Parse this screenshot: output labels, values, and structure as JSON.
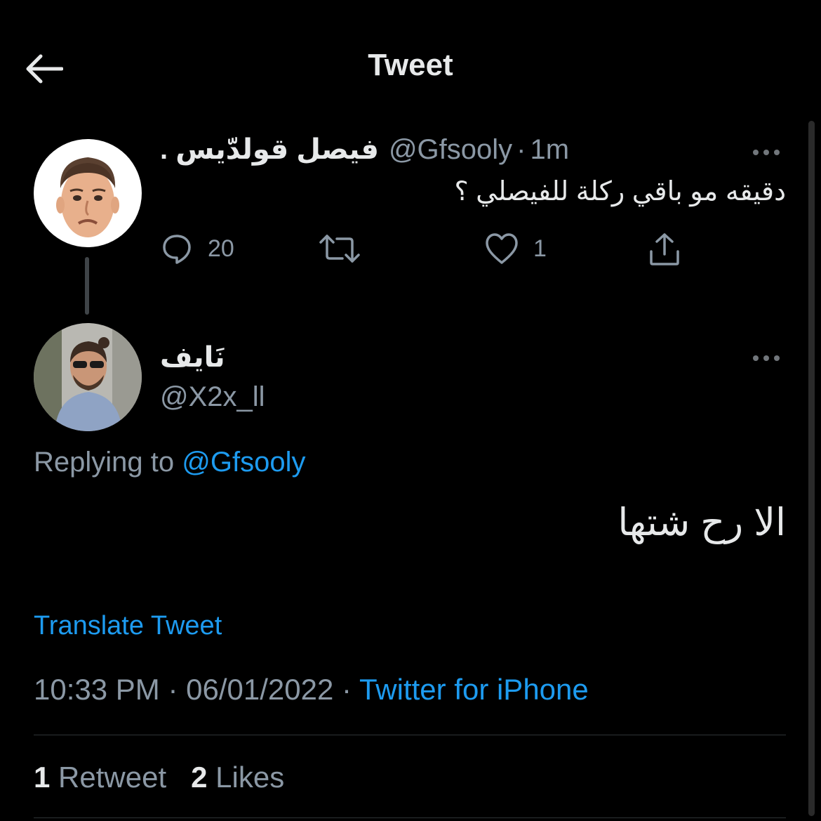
{
  "header": {
    "title": "Tweet",
    "back_icon": "back-arrow-icon"
  },
  "parent_tweet": {
    "display_name": "فيصل قولدّيس .",
    "handle": "@Gfsooly",
    "separator": "·",
    "time": "1m",
    "text": "دقيقه مو باقي ركلة للفيصلي ؟",
    "reply_count": "20",
    "like_count": "1",
    "icons": [
      "reply-icon",
      "retweet-icon",
      "like-icon",
      "share-icon",
      "more-icon"
    ]
  },
  "main_tweet": {
    "display_name": "نَايف",
    "handle": "@X2x_ll",
    "replying_label": "Replying to",
    "replying_handle": "@Gfsooly",
    "text": "الا رح شتها",
    "translate_label": "Translate Tweet",
    "time": "10:33 PM",
    "date": "06/01/2022",
    "meta_separator": "·",
    "source": "Twitter for iPhone",
    "retweets_count": "1",
    "retweets_label": "Retweet",
    "likes_count": "2",
    "likes_label": "Likes"
  },
  "colors": {
    "background": "#000000",
    "text_primary": "#e7e9ea",
    "text_secondary": "#8b98a5",
    "link": "#1d9bf0",
    "divider": "#2f3336"
  }
}
